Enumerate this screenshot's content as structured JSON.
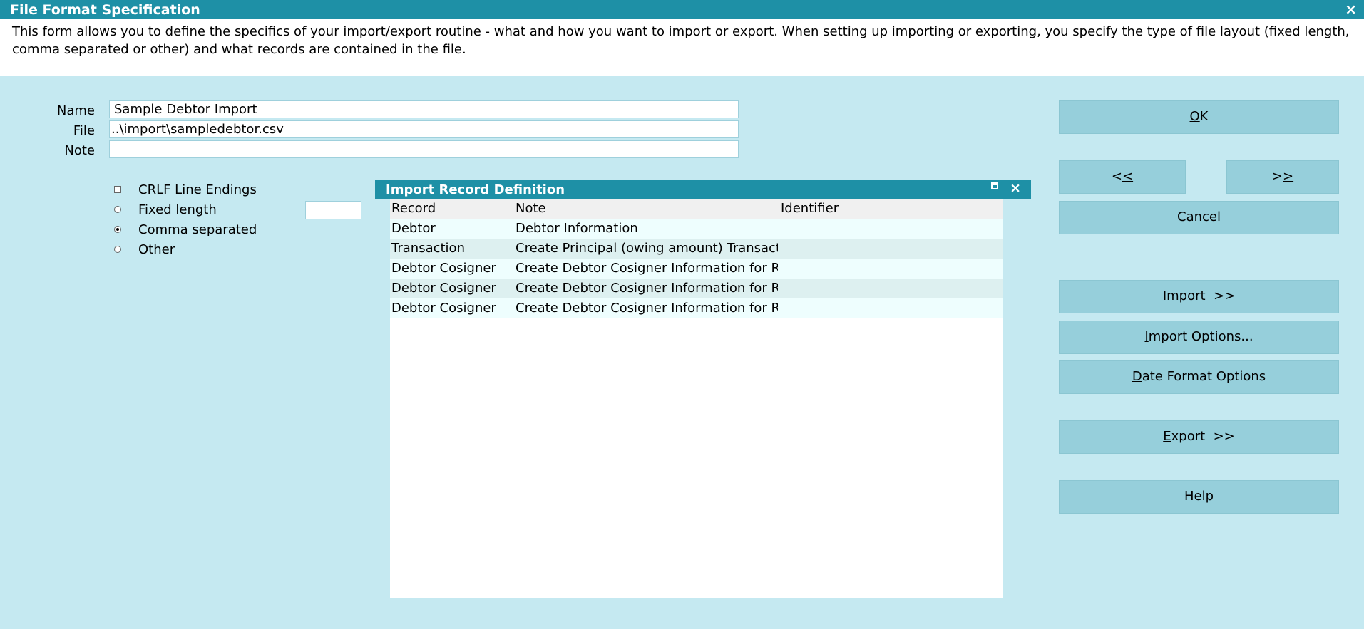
{
  "window": {
    "title": "File Format Specification",
    "close_glyph": "×"
  },
  "description": "This form allows you to define the specifics of your import/export routine - what and how you want to import or export. When setting up importing or exporting, you specify the type of file layout (fixed length, comma separated or other) and what records are contained in the file.",
  "form": {
    "name_label": "Name",
    "name_value": "Sample Debtor Import",
    "file_label": "File",
    "file_value": "..\\import\\sampledebtor.csv",
    "note_label": "Note",
    "note_value": ""
  },
  "options": {
    "crlf": {
      "label": "CRLF Line Endings",
      "checked": false
    },
    "fixed": {
      "label": "Fixed length",
      "selected": false,
      "length_value": ""
    },
    "comma": {
      "label": "Comma separated",
      "selected": true
    },
    "other": {
      "label": "Other",
      "selected": false
    }
  },
  "record_panel": {
    "title": "Import Record Definition",
    "close_glyph": "×",
    "columns": [
      "Record",
      "Note",
      "Identifier"
    ],
    "rows": [
      {
        "record": "Debtor",
        "note": "Debtor Information",
        "identifier": ""
      },
      {
        "record": "Transaction",
        "note": "Create Principal (owing amount) Transaction",
        "identifier": ""
      },
      {
        "record": "Debtor Cosigner",
        "note": "Create Debtor Cosigner Information for Refer",
        "identifier": ""
      },
      {
        "record": "Debtor Cosigner",
        "note": "Create Debtor Cosigner Information for Refer",
        "identifier": ""
      },
      {
        "record": "Debtor Cosigner",
        "note": "Create Debtor Cosigner Information for Refer",
        "identifier": ""
      }
    ]
  },
  "buttons": {
    "ok": {
      "pre": "",
      "key": "O",
      "post": "K"
    },
    "prev": {
      "pre": "<",
      "key": "<",
      "post": ""
    },
    "next": {
      "pre": ">",
      "key": ">",
      "post": ""
    },
    "cancel": {
      "pre": "",
      "key": "C",
      "post": "ancel"
    },
    "import": {
      "pre": "",
      "key": "I",
      "post": "mport  >>"
    },
    "import_options": {
      "pre": "",
      "key": "I",
      "post": "mport Options..."
    },
    "date_format": {
      "pre": "",
      "key": "D",
      "post": "ate Format Options"
    },
    "export": {
      "pre": "",
      "key": "E",
      "post": "xport  >>"
    },
    "help": {
      "pre": "",
      "key": "H",
      "post": "elp"
    }
  },
  "colors": {
    "titlebar": "#1e90a6",
    "background": "#c5e9f1",
    "button": "#96cfdb"
  }
}
